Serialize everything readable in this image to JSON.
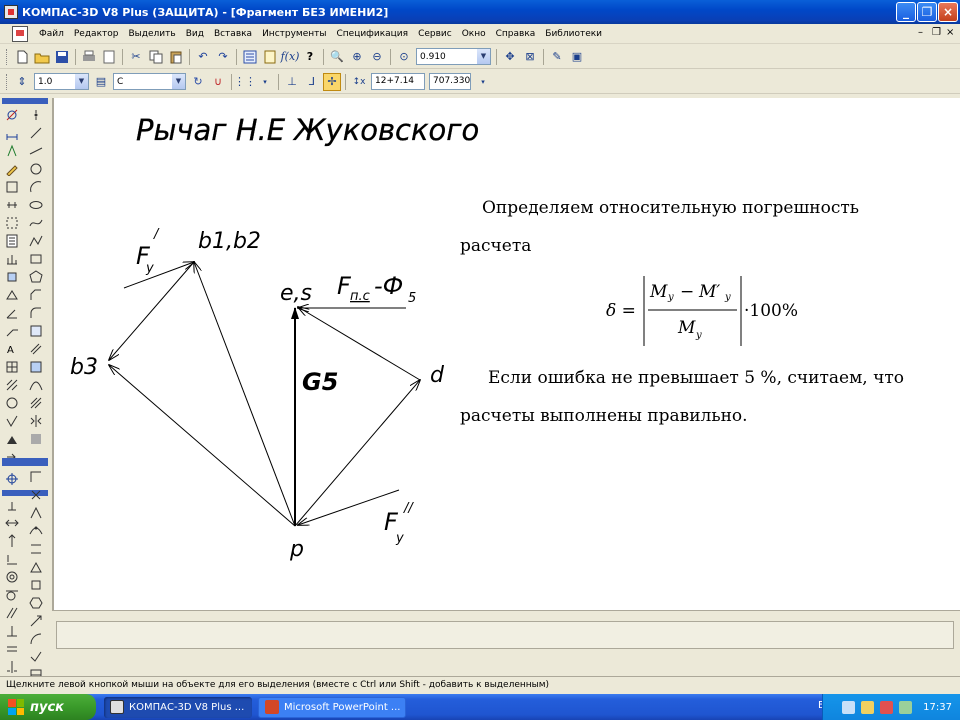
{
  "window": {
    "title": "КОМПАС-3D V8 Plus (ЗАЩИТА) - [Фрагмент БЕЗ ИМЕНИ2]"
  },
  "menu": {
    "items": [
      "Файл",
      "Редактор",
      "Выделить",
      "Вид",
      "Вставка",
      "Инструменты",
      "Спецификация",
      "Сервис",
      "Окно",
      "Справка",
      "Библиотеки"
    ]
  },
  "toolbar_main": {
    "zoom_value": "0.910"
  },
  "toolbar_props": {
    "line_scale": "1.0",
    "style": "C",
    "coord_x": "12+7.14",
    "coord_y": "707.330"
  },
  "drawing": {
    "heading": "Рычаг Н.Е Жуковского",
    "labels": {
      "b1b2": "b1,b2",
      "b3": "b3",
      "es": "e,s",
      "d": "d",
      "p": "p",
      "g5": "G5",
      "fy1_base": "F",
      "fy1_sub": "y",
      "fy1_sup": "/",
      "fy2_base": "F",
      "fy2_sub": "y",
      "fy2_sup": "//",
      "fpc": "F",
      "fpc_sub": "п.с",
      "phi": "-Ф",
      "phi_sub": "5"
    }
  },
  "explanation": {
    "line1": "Определяем относительную погрешность",
    "line2": "расчета",
    "formula_delta": "δ =",
    "formula_num": "M",
    "formula_num_sub": "у",
    "formula_minus": "−",
    "formula_num2": "M′",
    "formula_num2_sub": "у",
    "formula_den": "M",
    "formula_den_sub": "у",
    "formula_tail": "·100%",
    "line3": "Если ошибка не превышает 5 %, считаем, что",
    "line4": "расчеты выполнены правильно."
  },
  "status": {
    "hint": "Щелкните левой кнопкой мыши на объекте для его выделения (вместе с Ctrl или Shift - добавить к выделенным)"
  },
  "taskbar": {
    "start_label": "пуск",
    "tasks": [
      "КОМПАС-3D V8 Plus ...",
      "Microsoft PowerPoint ..."
    ],
    "lang": "EN",
    "clock": "17:37"
  },
  "colors": {
    "titlebar": "#0a5fd8",
    "taskbar": "#245edb",
    "start": "#3a9a2a",
    "canvas": "#ffffff"
  }
}
